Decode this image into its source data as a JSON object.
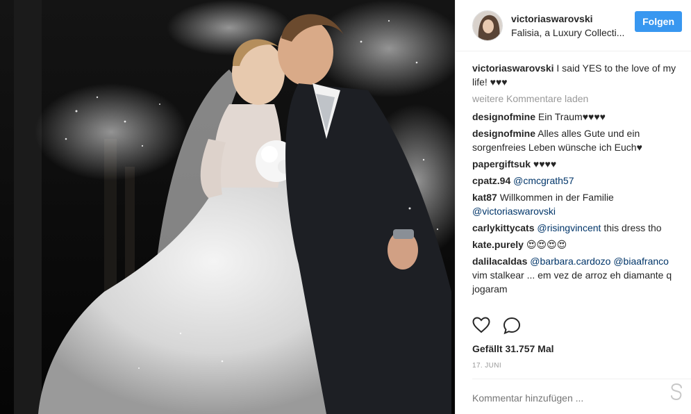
{
  "header": {
    "username": "victoriaswarovski",
    "location": "Falisia, a Luxury Collecti...",
    "follow_label": "Folgen"
  },
  "caption": {
    "username": "victoriaswarovski",
    "text": "I said YES to the love of my life! ♥♥♥"
  },
  "load_more_label": "weitere Kommentare laden",
  "comments": [
    {
      "user": "designofmine",
      "text": "Ein Traum♥♥♥♥"
    },
    {
      "user": "designofmine",
      "text": "Alles alles Gute und ein sorgenfreies Leben wünsche ich Euch♥"
    },
    {
      "user": "papergiftsuk",
      "text": "♥♥♥♥"
    },
    {
      "user": "cpatz.94",
      "mention": "@cmcgrath57",
      "text": ""
    },
    {
      "user": "kat87",
      "text": "Willkommen in der Familie",
      "mention": "@victoriaswarovski"
    },
    {
      "user": "carlykittycats",
      "mention": "@risingvincent",
      "text": "this dress tho"
    },
    {
      "user": "kate.purely",
      "text": "😍😍😍😍"
    },
    {
      "user": "dalilacaldas",
      "mention": "@barbara.cardozo",
      "mention2": "@biaafranco",
      "text": "vim stalkear ... em vez de arroz eh diamante q jogaram"
    }
  ],
  "likes_label": "Gefällt 31.757 Mal",
  "date_label": "17. JUNI",
  "add_comment_placeholder": "Kommentar hinzufügen ...",
  "icons": {
    "like": "heart-icon",
    "comment": "speech-bubble-icon",
    "more": "more-options-icon"
  },
  "colors": {
    "follow_button": "#3897f0",
    "mention": "#003569",
    "muted": "#999999"
  }
}
